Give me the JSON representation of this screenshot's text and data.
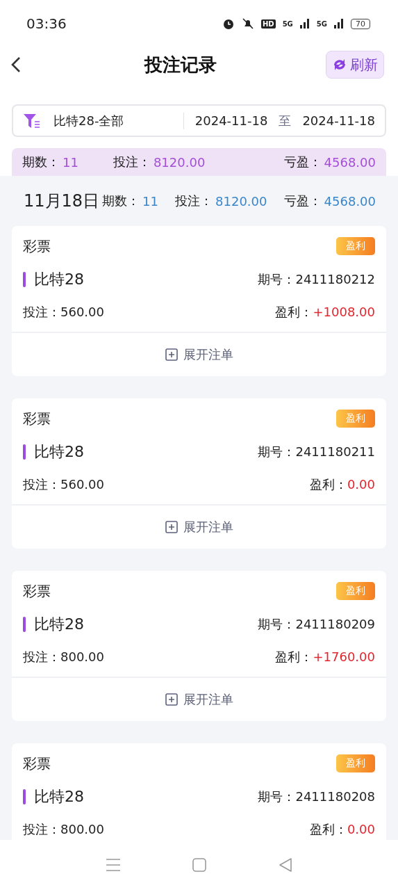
{
  "status_bar": {
    "time": "03:36",
    "hd": "HD",
    "network_1": "5G",
    "network_2": "5G",
    "battery": "70"
  },
  "header": {
    "title": "投注记录",
    "refresh": "刷新"
  },
  "filter": {
    "game": "比特28-全部",
    "date_from": "2024-11-18",
    "separator": "至",
    "date_to": "2024-11-18"
  },
  "summary": {
    "periods_label": "期数：",
    "periods": "11",
    "bet_label": "投注：",
    "bet": "8120.00",
    "pnl_label": "亏盈：",
    "pnl": "4568.00"
  },
  "day": {
    "date": "11月18日",
    "periods_label": "期数：",
    "periods": "11",
    "bet_label": "投注：",
    "bet": "8120.00",
    "pnl_label": "亏盈：",
    "pnl": "4568.00"
  },
  "records": [
    {
      "category": "彩票",
      "badge": "盈利",
      "game": "比特28",
      "issue_label": "期号：",
      "issue": "2411180212",
      "bet_label": "投注：",
      "bet": "560.00",
      "profit_label": "盈利：",
      "profit": "+1008.00",
      "expand": "展开注单"
    },
    {
      "category": "彩票",
      "badge": "盈利",
      "game": "比特28",
      "issue_label": "期号：",
      "issue": "2411180211",
      "bet_label": "投注：",
      "bet": "560.00",
      "profit_label": "盈利：",
      "profit": "0.00",
      "expand": "展开注单"
    },
    {
      "category": "彩票",
      "badge": "盈利",
      "game": "比特28",
      "issue_label": "期号：",
      "issue": "2411180209",
      "bet_label": "投注：",
      "bet": "800.00",
      "profit_label": "盈利：",
      "profit": "+1760.00",
      "expand": "展开注单"
    },
    {
      "category": "彩票",
      "badge": "盈利",
      "game": "比特28",
      "issue_label": "期号：",
      "issue": "2411180208",
      "bet_label": "投注：",
      "bet": "800.00",
      "profit_label": "盈利：",
      "profit": "0.00"
    }
  ]
}
